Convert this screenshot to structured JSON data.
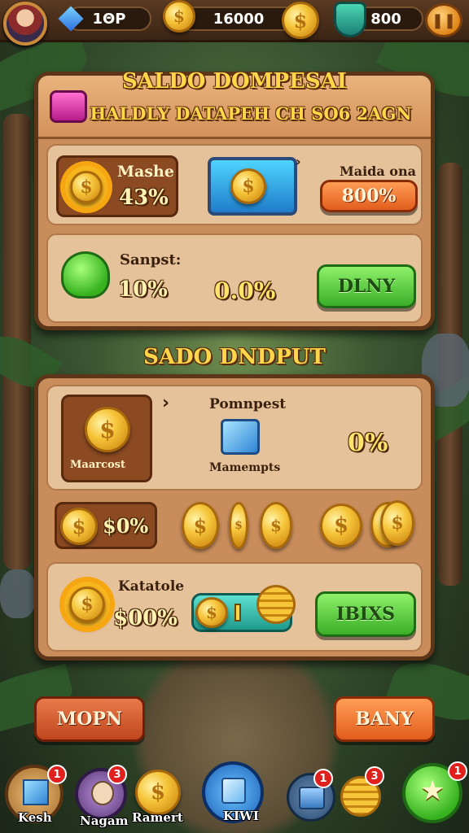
{
  "topbar": {
    "gems": "1ΘP",
    "coins": "16000",
    "shields": "800"
  },
  "panel1": {
    "title": "SALDO DOMPESAI",
    "subtitle": "HALDLY DATAPEH CH SO6 2AGN",
    "row1": {
      "left_label": "Mashe",
      "left_value": "43%",
      "right_label": "Maida ona",
      "right_value": "800%"
    },
    "row2": {
      "label": "Sanpst:",
      "left_value": "10%",
      "mid_value": "0.0%",
      "button": "DLNY"
    }
  },
  "panel2": {
    "title": "SADO DNDPUT",
    "row1": {
      "box_label": "Maarcost",
      "item_label": "Pomnpest",
      "item_sub": "Mamempts",
      "value": "0%"
    },
    "row2": {
      "value": "$0%"
    },
    "row3": {
      "label": "Katatole",
      "value": "$00%",
      "button": "IBIXS"
    }
  },
  "actions": {
    "left": "MOPN",
    "right": "BANY"
  },
  "nav": [
    {
      "label": "Kesh",
      "badge": "1",
      "icon": "cube-icon"
    },
    {
      "label": "Nagam",
      "badge": "3",
      "icon": "face-icon"
    },
    {
      "label": "Ramert",
      "badge": "",
      "icon": "coin-icon"
    },
    {
      "label": "KIWI",
      "badge": "",
      "icon": "blue-cube-icon"
    },
    {
      "label": "",
      "badge": "1",
      "icon": "chest-icon"
    },
    {
      "label": "",
      "badge": "3",
      "icon": "coin-stack-icon"
    },
    {
      "label": "",
      "badge": "1",
      "icon": "star-icon"
    }
  ],
  "colors": {
    "panel": "#c98d5c",
    "panel_border": "#5d3619",
    "title_gold": "#ffd64a",
    "green_button": "#3aae27",
    "orange_button": "#e25d1d"
  }
}
